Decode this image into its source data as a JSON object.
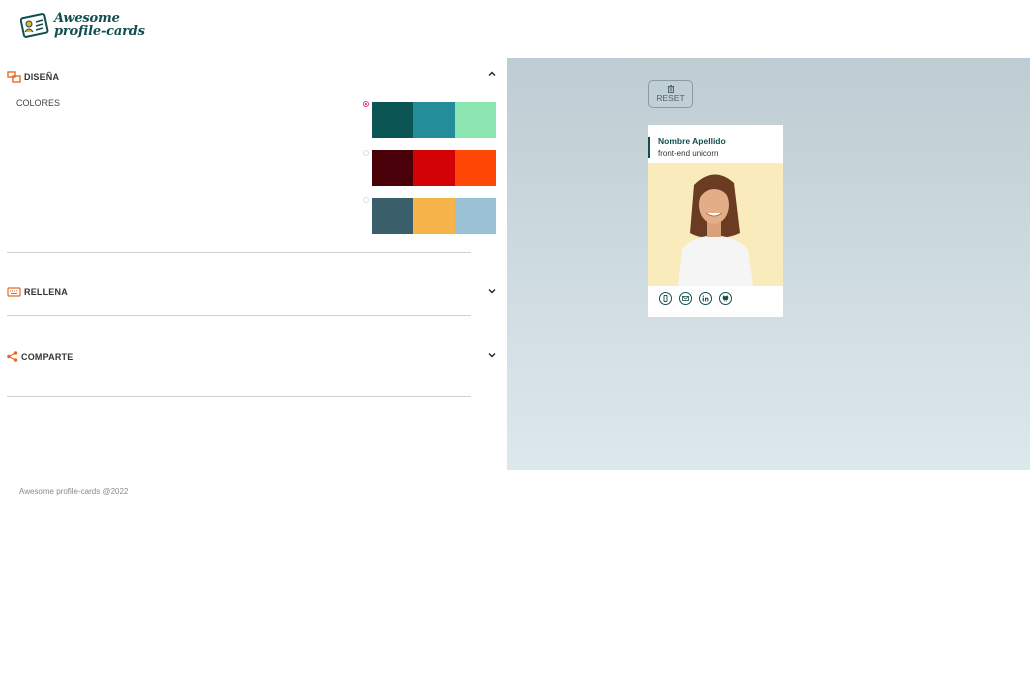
{
  "header": {
    "logo_line1": "Awesome",
    "logo_line2": "profile-cards"
  },
  "panel": {
    "design": {
      "title": "DISEÑA",
      "expanded": true
    },
    "colors_label": "COLORES",
    "palettes": [
      {
        "selected": true,
        "colors": [
          "#0b5654",
          "#238e9a",
          "#8de6b2"
        ]
      },
      {
        "selected": false,
        "colors": [
          "#4a0008",
          "#d10306",
          "#ff4806"
        ]
      },
      {
        "selected": false,
        "colors": [
          "#39606a",
          "#f5b349",
          "#9bc2d4"
        ]
      }
    ],
    "fill": {
      "title": "RELLENA",
      "expanded": false
    },
    "share": {
      "title": "COMPARTE",
      "expanded": false
    }
  },
  "footer": {
    "text": "Awesome profile-cards @2022"
  },
  "preview": {
    "reset_label": "RESET",
    "card": {
      "name": "Nombre Apellido",
      "job": "front-end unicorn"
    },
    "icons": [
      "phone-icon",
      "mail-icon",
      "linkedin-icon",
      "github-icon"
    ]
  },
  "colors": {
    "accent": "#e56b28",
    "brand": "#114e4e",
    "radio_selected": "#e8368f"
  }
}
